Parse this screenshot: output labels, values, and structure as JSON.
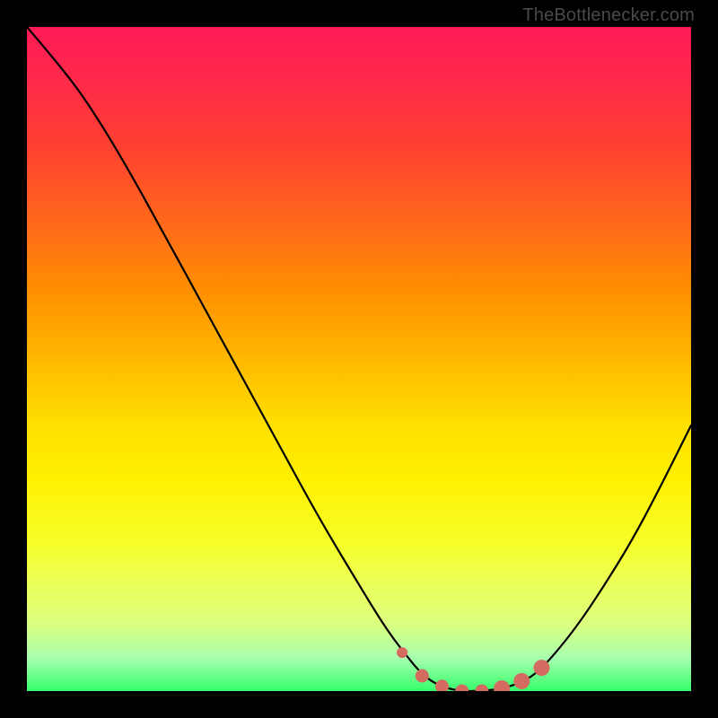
{
  "attribution": "TheBottleneсker.com",
  "chart_data": {
    "type": "line",
    "title": "",
    "xlabel": "",
    "ylabel": "",
    "x_range": [
      0,
      1
    ],
    "y_range": [
      0,
      1
    ],
    "series": [
      {
        "name": "curve",
        "color": "#000000",
        "points": [
          {
            "x": 0.0,
            "y": 1.0
          },
          {
            "x": 0.06,
            "y": 0.93
          },
          {
            "x": 0.105,
            "y": 0.865
          },
          {
            "x": 0.15,
            "y": 0.79
          },
          {
            "x": 0.2,
            "y": 0.7
          },
          {
            "x": 0.26,
            "y": 0.59
          },
          {
            "x": 0.32,
            "y": 0.48
          },
          {
            "x": 0.38,
            "y": 0.37
          },
          {
            "x": 0.44,
            "y": 0.26
          },
          {
            "x": 0.5,
            "y": 0.16
          },
          {
            "x": 0.54,
            "y": 0.095
          },
          {
            "x": 0.57,
            "y": 0.055
          },
          {
            "x": 0.595,
            "y": 0.025
          },
          {
            "x": 0.62,
            "y": 0.008
          },
          {
            "x": 0.65,
            "y": 0.0
          },
          {
            "x": 0.685,
            "y": 0.0
          },
          {
            "x": 0.72,
            "y": 0.004
          },
          {
            "x": 0.76,
            "y": 0.02
          },
          {
            "x": 0.79,
            "y": 0.05
          },
          {
            "x": 0.83,
            "y": 0.1
          },
          {
            "x": 0.87,
            "y": 0.16
          },
          {
            "x": 0.91,
            "y": 0.225
          },
          {
            "x": 0.95,
            "y": 0.3
          },
          {
            "x": 1.0,
            "y": 0.4
          }
        ]
      },
      {
        "name": "markers",
        "color": "#d36b60",
        "points": [
          {
            "x": 0.565,
            "y": 0.058
          },
          {
            "x": 0.595,
            "y": 0.023
          },
          {
            "x": 0.625,
            "y": 0.007
          },
          {
            "x": 0.655,
            "y": 0.0
          },
          {
            "x": 0.685,
            "y": 0.0
          },
          {
            "x": 0.715,
            "y": 0.004
          },
          {
            "x": 0.745,
            "y": 0.015
          },
          {
            "x": 0.775,
            "y": 0.035
          }
        ]
      }
    ]
  }
}
